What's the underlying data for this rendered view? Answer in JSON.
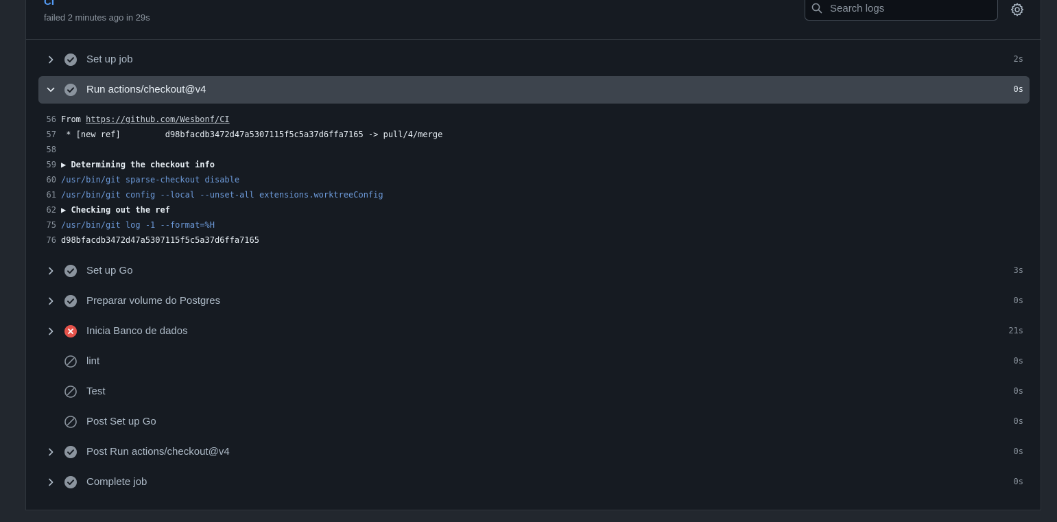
{
  "job": {
    "name": "CI",
    "status": "failed 2 minutes ago in 29s"
  },
  "search": {
    "placeholder": "Search logs"
  },
  "steps": [
    {
      "label": "Set up job",
      "duration": "2s",
      "status": "success",
      "expandable": true
    },
    {
      "label": "Run actions/checkout@v4",
      "duration": "0s",
      "status": "success",
      "expandable": true,
      "expanded": true
    },
    {
      "label": "Set up Go",
      "duration": "3s",
      "status": "success",
      "expandable": true
    },
    {
      "label": "Preparar volume do Postgres",
      "duration": "0s",
      "status": "success",
      "expandable": true
    },
    {
      "label": "Inicia Banco de dados",
      "duration": "21s",
      "status": "failure",
      "expandable": true
    },
    {
      "label": "lint",
      "duration": "0s",
      "status": "skipped",
      "expandable": false
    },
    {
      "label": "Test",
      "duration": "0s",
      "status": "skipped",
      "expandable": false
    },
    {
      "label": "Post Set up Go",
      "duration": "0s",
      "status": "skipped",
      "expandable": false
    },
    {
      "label": "Post Run actions/checkout@v4",
      "duration": "0s",
      "status": "success",
      "expandable": true
    },
    {
      "label": "Complete job",
      "duration": "0s",
      "status": "success",
      "expandable": true
    }
  ],
  "log": {
    "lines": [
      {
        "num": "56",
        "prefix": "From ",
        "link": "https://github.com/Wesbonf/CI",
        "type": "link"
      },
      {
        "num": "57",
        "text": " * [new ref]         d98bfacdb3472d47a5307115f5c5a37d6ffa7165 -> pull/4/merge",
        "type": "plain"
      },
      {
        "num": "58",
        "text": "",
        "type": "plain"
      },
      {
        "num": "59",
        "text": "▶ Determining the checkout info",
        "type": "group"
      },
      {
        "num": "60",
        "text": "/usr/bin/git sparse-checkout disable",
        "type": "cmd"
      },
      {
        "num": "61",
        "text": "/usr/bin/git config --local --unset-all extensions.worktreeConfig",
        "type": "cmd"
      },
      {
        "num": "62",
        "text": "▶ Checking out the ref",
        "type": "group"
      },
      {
        "num": "75",
        "text": "/usr/bin/git log -1 --format=%H",
        "type": "cmd"
      },
      {
        "num": "76",
        "text": "d98bfacdb3472d47a5307115f5c5a37d6ffa7165",
        "type": "plain"
      }
    ]
  },
  "colors": {
    "success": "#8b949e",
    "failure": "#e5534b",
    "link_accent": "#539bf5"
  }
}
